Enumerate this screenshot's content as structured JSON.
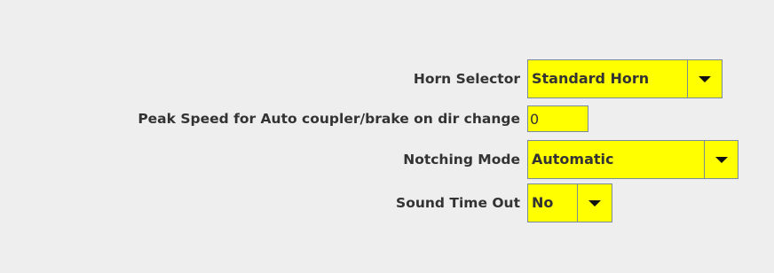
{
  "settings": {
    "horn_selector": {
      "label": "Horn Selector",
      "value": "Standard Horn"
    },
    "peak_speed": {
      "label": "Peak Speed for Auto coupler/brake on dir change",
      "value": "0"
    },
    "notching_mode": {
      "label": "Notching Mode",
      "value": "Automatic"
    },
    "sound_time_out": {
      "label": "Sound Time Out",
      "value": "No"
    }
  },
  "colors": {
    "window_bg": "#eeeeee",
    "field_bg": "#ffff00",
    "field_border": "#7a8a99",
    "text": "#333333"
  }
}
